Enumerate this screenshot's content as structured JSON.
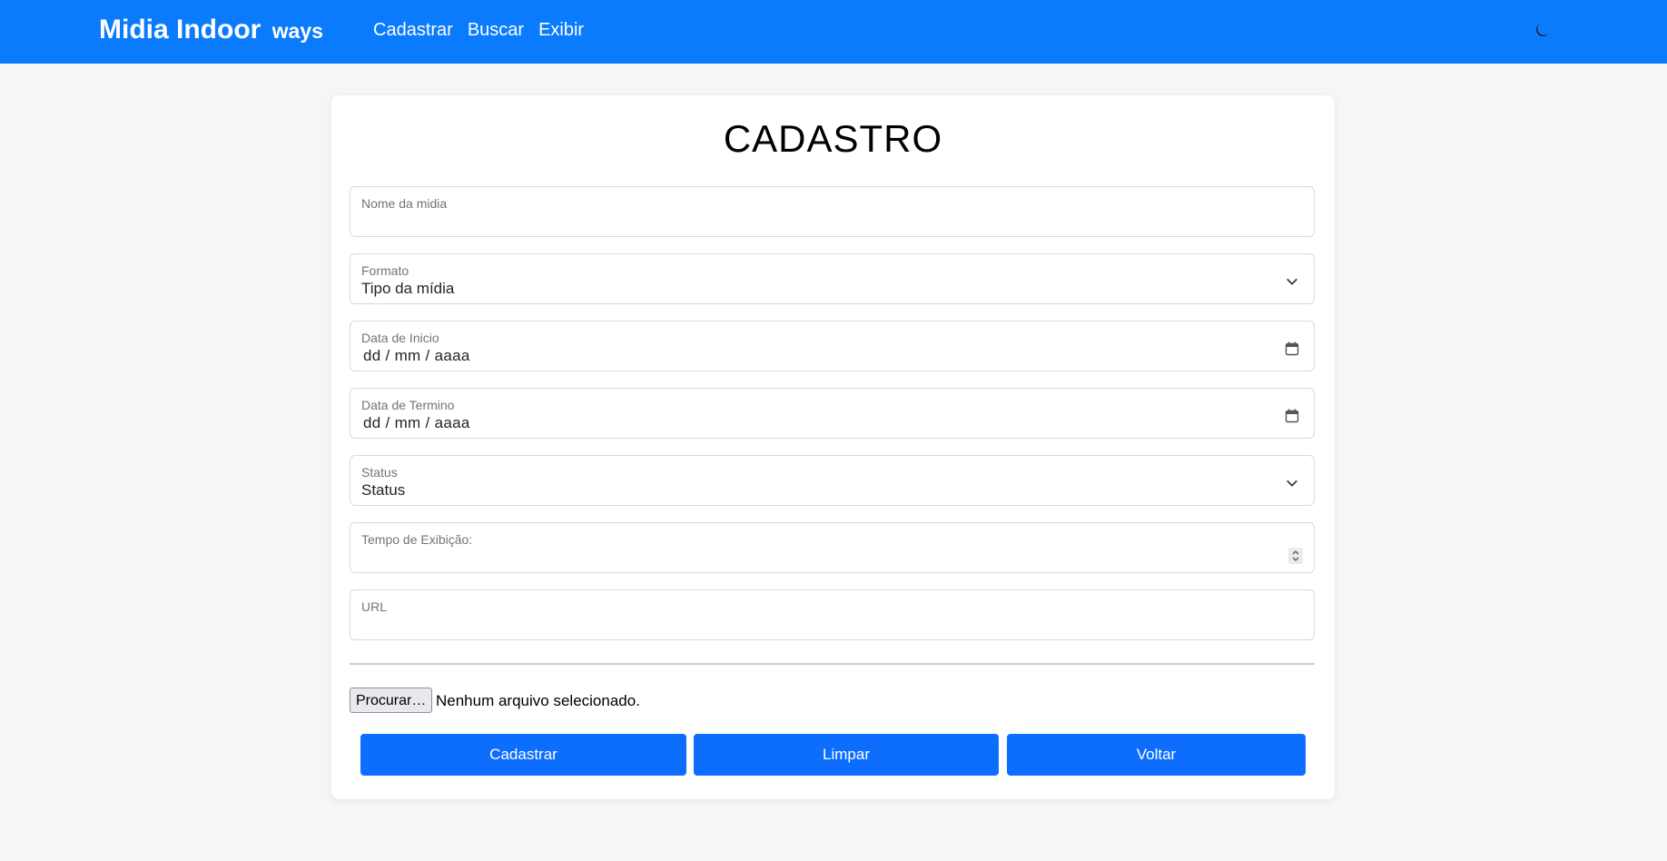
{
  "navbar": {
    "brand": "Midia Indoor",
    "brand_sub": "ways",
    "links": [
      "Cadastrar",
      "Buscar",
      "Exibir"
    ],
    "theme_icon": "moon-icon",
    "bg_color": "#0b7bfd"
  },
  "form": {
    "title": "CADASTRO",
    "nome": {
      "label": "Nome da midia",
      "value": ""
    },
    "formato": {
      "label": "Formato",
      "value": "Tipo da mídia"
    },
    "data_inicio": {
      "label": "Data de Inicio",
      "value": "dd / mm / aaaa"
    },
    "data_termino": {
      "label": "Data de Termino",
      "value": "dd / mm / aaaa"
    },
    "status": {
      "label": "Status",
      "value": "Status"
    },
    "tempo": {
      "label": "Tempo de Exibição:",
      "value": ""
    },
    "url": {
      "label": "URL",
      "value": ""
    },
    "file": {
      "button": "Procurar…",
      "status": "Nenhum arquivo selecionado."
    },
    "buttons": {
      "cadastrar": "Cadastrar",
      "limpar": "Limpar",
      "voltar": "Voltar"
    },
    "button_color": "#0d6efd"
  }
}
